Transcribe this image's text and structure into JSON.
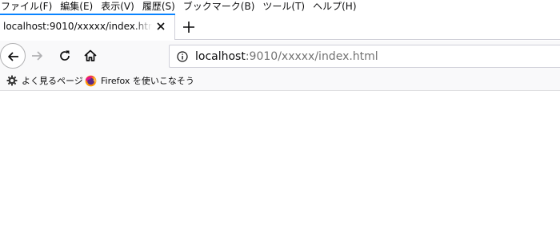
{
  "menu": {
    "items": [
      {
        "label": "ファイル(F)"
      },
      {
        "label": "編集(E)"
      },
      {
        "label": "表示(V)"
      },
      {
        "label": "履歴(S)"
      },
      {
        "label": "ブックマーク(B)"
      },
      {
        "label": "ツール(T)"
      },
      {
        "label": "ヘルプ(H)"
      }
    ]
  },
  "tab": {
    "title": "localhost:9010/xxxxx/index.html",
    "accent_color": "#0a84ff",
    "close_icon": "close-icon",
    "new_tab_icon": "plus-icon"
  },
  "navigation": {
    "back_icon": "arrow-left-icon",
    "forward_icon": "arrow-right-icon",
    "reload_icon": "reload-icon",
    "home_icon": "home-icon"
  },
  "urlbar": {
    "host": "localhost",
    "rest": ":9010/xxxxx/index.html",
    "info_icon": "info-icon"
  },
  "bookmarks": {
    "items": [
      {
        "label": "よく見るページ",
        "icon": "gear-icon"
      },
      {
        "label": "Firefox を使いこなそう",
        "icon": "firefox-icon"
      }
    ]
  }
}
